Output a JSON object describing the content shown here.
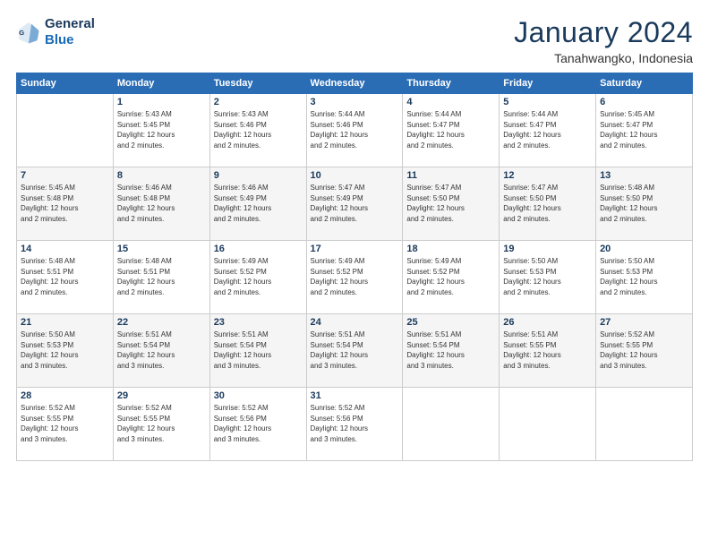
{
  "logo": {
    "line1": "General",
    "line2": "Blue"
  },
  "title": "January 2024",
  "location": "Tanahwangko, Indonesia",
  "weekdays": [
    "Sunday",
    "Monday",
    "Tuesday",
    "Wednesday",
    "Thursday",
    "Friday",
    "Saturday"
  ],
  "weeks": [
    [
      {
        "day": "",
        "info": ""
      },
      {
        "day": "1",
        "info": "Sunrise: 5:43 AM\nSunset: 5:45 PM\nDaylight: 12 hours\nand 2 minutes."
      },
      {
        "day": "2",
        "info": "Sunrise: 5:43 AM\nSunset: 5:46 PM\nDaylight: 12 hours\nand 2 minutes."
      },
      {
        "day": "3",
        "info": "Sunrise: 5:44 AM\nSunset: 5:46 PM\nDaylight: 12 hours\nand 2 minutes."
      },
      {
        "day": "4",
        "info": "Sunrise: 5:44 AM\nSunset: 5:47 PM\nDaylight: 12 hours\nand 2 minutes."
      },
      {
        "day": "5",
        "info": "Sunrise: 5:44 AM\nSunset: 5:47 PM\nDaylight: 12 hours\nand 2 minutes."
      },
      {
        "day": "6",
        "info": "Sunrise: 5:45 AM\nSunset: 5:47 PM\nDaylight: 12 hours\nand 2 minutes."
      }
    ],
    [
      {
        "day": "7",
        "info": "Sunrise: 5:45 AM\nSunset: 5:48 PM\nDaylight: 12 hours\nand 2 minutes."
      },
      {
        "day": "8",
        "info": "Sunrise: 5:46 AM\nSunset: 5:48 PM\nDaylight: 12 hours\nand 2 minutes."
      },
      {
        "day": "9",
        "info": "Sunrise: 5:46 AM\nSunset: 5:49 PM\nDaylight: 12 hours\nand 2 minutes."
      },
      {
        "day": "10",
        "info": "Sunrise: 5:47 AM\nSunset: 5:49 PM\nDaylight: 12 hours\nand 2 minutes."
      },
      {
        "day": "11",
        "info": "Sunrise: 5:47 AM\nSunset: 5:50 PM\nDaylight: 12 hours\nand 2 minutes."
      },
      {
        "day": "12",
        "info": "Sunrise: 5:47 AM\nSunset: 5:50 PM\nDaylight: 12 hours\nand 2 minutes."
      },
      {
        "day": "13",
        "info": "Sunrise: 5:48 AM\nSunset: 5:50 PM\nDaylight: 12 hours\nand 2 minutes."
      }
    ],
    [
      {
        "day": "14",
        "info": "Sunrise: 5:48 AM\nSunset: 5:51 PM\nDaylight: 12 hours\nand 2 minutes."
      },
      {
        "day": "15",
        "info": "Sunrise: 5:48 AM\nSunset: 5:51 PM\nDaylight: 12 hours\nand 2 minutes."
      },
      {
        "day": "16",
        "info": "Sunrise: 5:49 AM\nSunset: 5:52 PM\nDaylight: 12 hours\nand 2 minutes."
      },
      {
        "day": "17",
        "info": "Sunrise: 5:49 AM\nSunset: 5:52 PM\nDaylight: 12 hours\nand 2 minutes."
      },
      {
        "day": "18",
        "info": "Sunrise: 5:49 AM\nSunset: 5:52 PM\nDaylight: 12 hours\nand 2 minutes."
      },
      {
        "day": "19",
        "info": "Sunrise: 5:50 AM\nSunset: 5:53 PM\nDaylight: 12 hours\nand 2 minutes."
      },
      {
        "day": "20",
        "info": "Sunrise: 5:50 AM\nSunset: 5:53 PM\nDaylight: 12 hours\nand 2 minutes."
      }
    ],
    [
      {
        "day": "21",
        "info": "Sunrise: 5:50 AM\nSunset: 5:53 PM\nDaylight: 12 hours\nand 3 minutes."
      },
      {
        "day": "22",
        "info": "Sunrise: 5:51 AM\nSunset: 5:54 PM\nDaylight: 12 hours\nand 3 minutes."
      },
      {
        "day": "23",
        "info": "Sunrise: 5:51 AM\nSunset: 5:54 PM\nDaylight: 12 hours\nand 3 minutes."
      },
      {
        "day": "24",
        "info": "Sunrise: 5:51 AM\nSunset: 5:54 PM\nDaylight: 12 hours\nand 3 minutes."
      },
      {
        "day": "25",
        "info": "Sunrise: 5:51 AM\nSunset: 5:54 PM\nDaylight: 12 hours\nand 3 minutes."
      },
      {
        "day": "26",
        "info": "Sunrise: 5:51 AM\nSunset: 5:55 PM\nDaylight: 12 hours\nand 3 minutes."
      },
      {
        "day": "27",
        "info": "Sunrise: 5:52 AM\nSunset: 5:55 PM\nDaylight: 12 hours\nand 3 minutes."
      }
    ],
    [
      {
        "day": "28",
        "info": "Sunrise: 5:52 AM\nSunset: 5:55 PM\nDaylight: 12 hours\nand 3 minutes."
      },
      {
        "day": "29",
        "info": "Sunrise: 5:52 AM\nSunset: 5:55 PM\nDaylight: 12 hours\nand 3 minutes."
      },
      {
        "day": "30",
        "info": "Sunrise: 5:52 AM\nSunset: 5:56 PM\nDaylight: 12 hours\nand 3 minutes."
      },
      {
        "day": "31",
        "info": "Sunrise: 5:52 AM\nSunset: 5:56 PM\nDaylight: 12 hours\nand 3 minutes."
      },
      {
        "day": "",
        "info": ""
      },
      {
        "day": "",
        "info": ""
      },
      {
        "day": "",
        "info": ""
      }
    ]
  ]
}
